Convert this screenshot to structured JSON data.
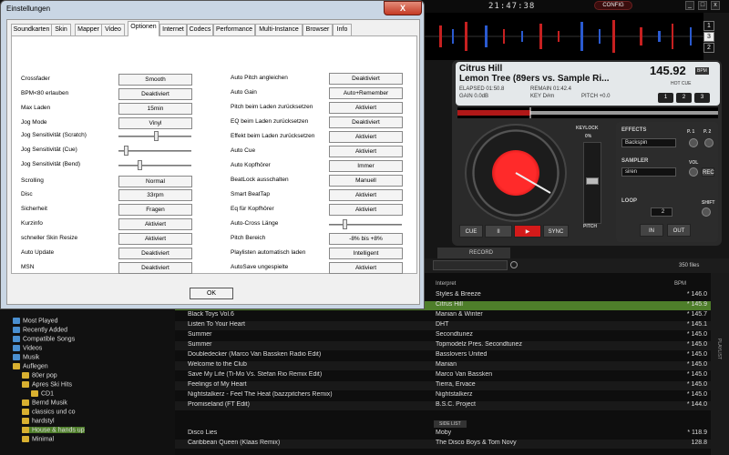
{
  "vdj": {
    "clock": "21:47:38",
    "config_button": "CONFIG",
    "window_controls": [
      "_",
      "□",
      "x"
    ],
    "deck_buttons": [
      "1",
      "3",
      "2"
    ],
    "deck": {
      "artist": "Citrus Hill",
      "title": "Lemon Tree (89ers vs. Sample Ri...",
      "bpm": "145.92",
      "bpm_unit": "BPM",
      "elapsed": "ELAPSED 01:50.8",
      "remain": "REMAIN 01:42.4",
      "gain": "GAIN 0.0dB",
      "key": "KEY D#m",
      "pitch": "PITCH +0.0",
      "hotcue_label": "HOT CUE",
      "hotcues": [
        "1",
        "2",
        "3"
      ],
      "keylock_label": "KEYLOCK",
      "keylock_value": "0%",
      "pitch_label": "PITCH",
      "transport": [
        "CUE",
        "II",
        "▶",
        "SYNC"
      ]
    },
    "fx": {
      "effects_label": "EFFECTS",
      "effect_value": "Backspin",
      "p1": "P. 1",
      "p2": "P. 2",
      "sampler_label": "SAMPLER",
      "sampler_value": "siren",
      "vol_label": "VOL",
      "rec_label": "REC",
      "loop_label": "LOOP",
      "loop_value": "2",
      "shift_label": "SHIFT",
      "in_label": "IN",
      "out_label": "OUT"
    },
    "record_tab": "RECORD",
    "files_count": "350 files",
    "side_list_label": "SIDE LIST",
    "playlist_label": "PLAYLIST",
    "columns": {
      "interpret": "Interpret",
      "bpm": "BPM"
    },
    "tracks": [
      {
        "title": "",
        "artist": "Styles & Breeze",
        "bpm": "* 146.0"
      },
      {
        "title": "",
        "artist": "Citrus Hill",
        "bpm": "* 145.9"
      },
      {
        "title": "Black Toys Vol.6",
        "artist": "Manian & Winter",
        "bpm": "* 145.7"
      },
      {
        "title": "Listen To Your Heart",
        "artist": "DHT",
        "bpm": "* 145.1"
      },
      {
        "title": "Summer",
        "artist": "Secondtunez",
        "bpm": "* 145.0"
      },
      {
        "title": "Summer",
        "artist": "Topmodelz Pres. Secondtunez",
        "bpm": "* 145.0"
      },
      {
        "title": "Doubledecker (Marco Van Bassken Radio Edit)",
        "artist": "Basslovers United",
        "bpm": "* 145.0"
      },
      {
        "title": "Welcome to the Club",
        "artist": "Manian",
        "bpm": "* 145.0"
      },
      {
        "title": "Save My Life (Ti-Mo Vs. Stefan Rio Remix Edit)",
        "artist": "Marco Van Bassken",
        "bpm": "* 145.0"
      },
      {
        "title": "Feelings of My Heart",
        "artist": "Tierra, Ervace",
        "bpm": "* 145.0"
      },
      {
        "title": "Nightstalkerz - Feel The Heat (bazzpitchers Remix)",
        "artist": "Nightstalkerz",
        "bpm": "* 145.0"
      },
      {
        "title": "Promiseland (FT Edit)",
        "artist": "B.S.C. Project",
        "bpm": "* 144.0"
      },
      {
        "title": "Disco Lies",
        "artist": "Moby",
        "bpm": "* 118.9"
      },
      {
        "title": "Caribbean Queen (Klaas Remix)",
        "artist": "The Disco Boys & Tom Novy",
        "bpm": "128.8"
      }
    ],
    "tree": [
      {
        "label": "Most Played",
        "icon": "folder-blue-icon"
      },
      {
        "label": "Recently Added",
        "icon": "folder-blue-icon"
      },
      {
        "label": "Compatible Songs",
        "icon": "folder-blue-icon"
      },
      {
        "label": "Videos",
        "icon": "folder-blue-icon"
      },
      {
        "label": "Musik",
        "icon": "folder-blue-icon"
      },
      {
        "label": "Auflegen",
        "icon": "folder-icon"
      },
      {
        "label": "80er pop",
        "icon": "folder-icon"
      },
      {
        "label": "Apres Ski Hits",
        "icon": "folder-icon"
      },
      {
        "label": "CD1",
        "icon": "folder-icon"
      },
      {
        "label": "Bernd Musik",
        "icon": "folder-icon"
      },
      {
        "label": "classics und co",
        "icon": "folder-icon"
      },
      {
        "label": "hardstyl",
        "icon": "folder-icon"
      },
      {
        "label": "House & hands up",
        "icon": "folder-icon"
      },
      {
        "label": "Minimal",
        "icon": "folder-icon"
      }
    ]
  },
  "dialog": {
    "title": "Einstellungen",
    "close": "X",
    "tabs": [
      "Soundkarten",
      "Skin",
      "Mapper",
      "Video",
      "Optionen",
      "Internet",
      "Codecs",
      "Performance",
      "Multi-Instance",
      "Browser",
      "Info"
    ],
    "active_tab": "Optionen",
    "left": [
      {
        "label": "Crossfader",
        "value": "Smooth",
        "type": "button"
      },
      {
        "label": "BPM<80 erlauben",
        "value": "Deaktiviert",
        "type": "button"
      },
      {
        "label": "Max Laden",
        "value": "15min",
        "type": "button"
      },
      {
        "label": "Jog Mode",
        "value": "Vinyl",
        "type": "button"
      },
      {
        "label": "Jog Sensitivität (Scratch)",
        "value": 0.52,
        "type": "slider"
      },
      {
        "label": "Jog Sensitivität (Cue)",
        "value": 0.08,
        "type": "slider"
      },
      {
        "label": "Jog Sensitivität (Bend)",
        "value": 0.28,
        "type": "slider"
      },
      {
        "label": "Scrolling",
        "value": "Normal",
        "type": "button"
      },
      {
        "label": "Disc",
        "value": "33rpm",
        "type": "button"
      },
      {
        "label": "Sicherheit",
        "value": "Fragen",
        "type": "button"
      },
      {
        "label": "Kurzinfo",
        "value": "Aktiviert",
        "type": "button"
      },
      {
        "label": "schneller Skin Resize",
        "value": "Aktiviert",
        "type": "button"
      },
      {
        "label": "Auto Update",
        "value": "Deaktiviert",
        "type": "button"
      },
      {
        "label": "MSN",
        "value": "Deaktiviert",
        "type": "button"
      }
    ],
    "right": [
      {
        "label": "Auto Pitch angleichen",
        "value": "Deaktiviert",
        "type": "button"
      },
      {
        "label": "Auto Gain",
        "value": "Auto+Remember",
        "type": "button"
      },
      {
        "label": "Pitch beim Laden zurücksetzen",
        "value": "Aktiviert",
        "type": "button"
      },
      {
        "label": "EQ beim Laden zurücksetzen",
        "value": "Deaktiviert",
        "type": "button"
      },
      {
        "label": "Effekt beim Laden zurücksetzen",
        "value": "Aktiviert",
        "type": "button"
      },
      {
        "label": "Auto Cue",
        "value": "Aktiviert",
        "type": "button"
      },
      {
        "label": "Auto Kopfhörer",
        "value": "Immer",
        "type": "button"
      },
      {
        "label": "BeatLock ausschalten",
        "value": "Manuell",
        "type": "button"
      },
      {
        "label": "Smart BeatTap",
        "value": "Aktiviert",
        "type": "button"
      },
      {
        "label": "Eq für Kopfhörer",
        "value": "Aktiviert",
        "type": "button"
      },
      {
        "label": "Auto-Cross Länge",
        "value": 0.2,
        "type": "slider"
      },
      {
        "label": "Pitch Bereich",
        "value": "-8% bis +8%",
        "type": "button"
      },
      {
        "label": "Playlisten automatisch laden",
        "value": "Intelligent",
        "type": "button"
      },
      {
        "label": "AutoSave ungespielte",
        "value": "Aktiviert",
        "type": "button"
      }
    ],
    "ok": "OK"
  }
}
